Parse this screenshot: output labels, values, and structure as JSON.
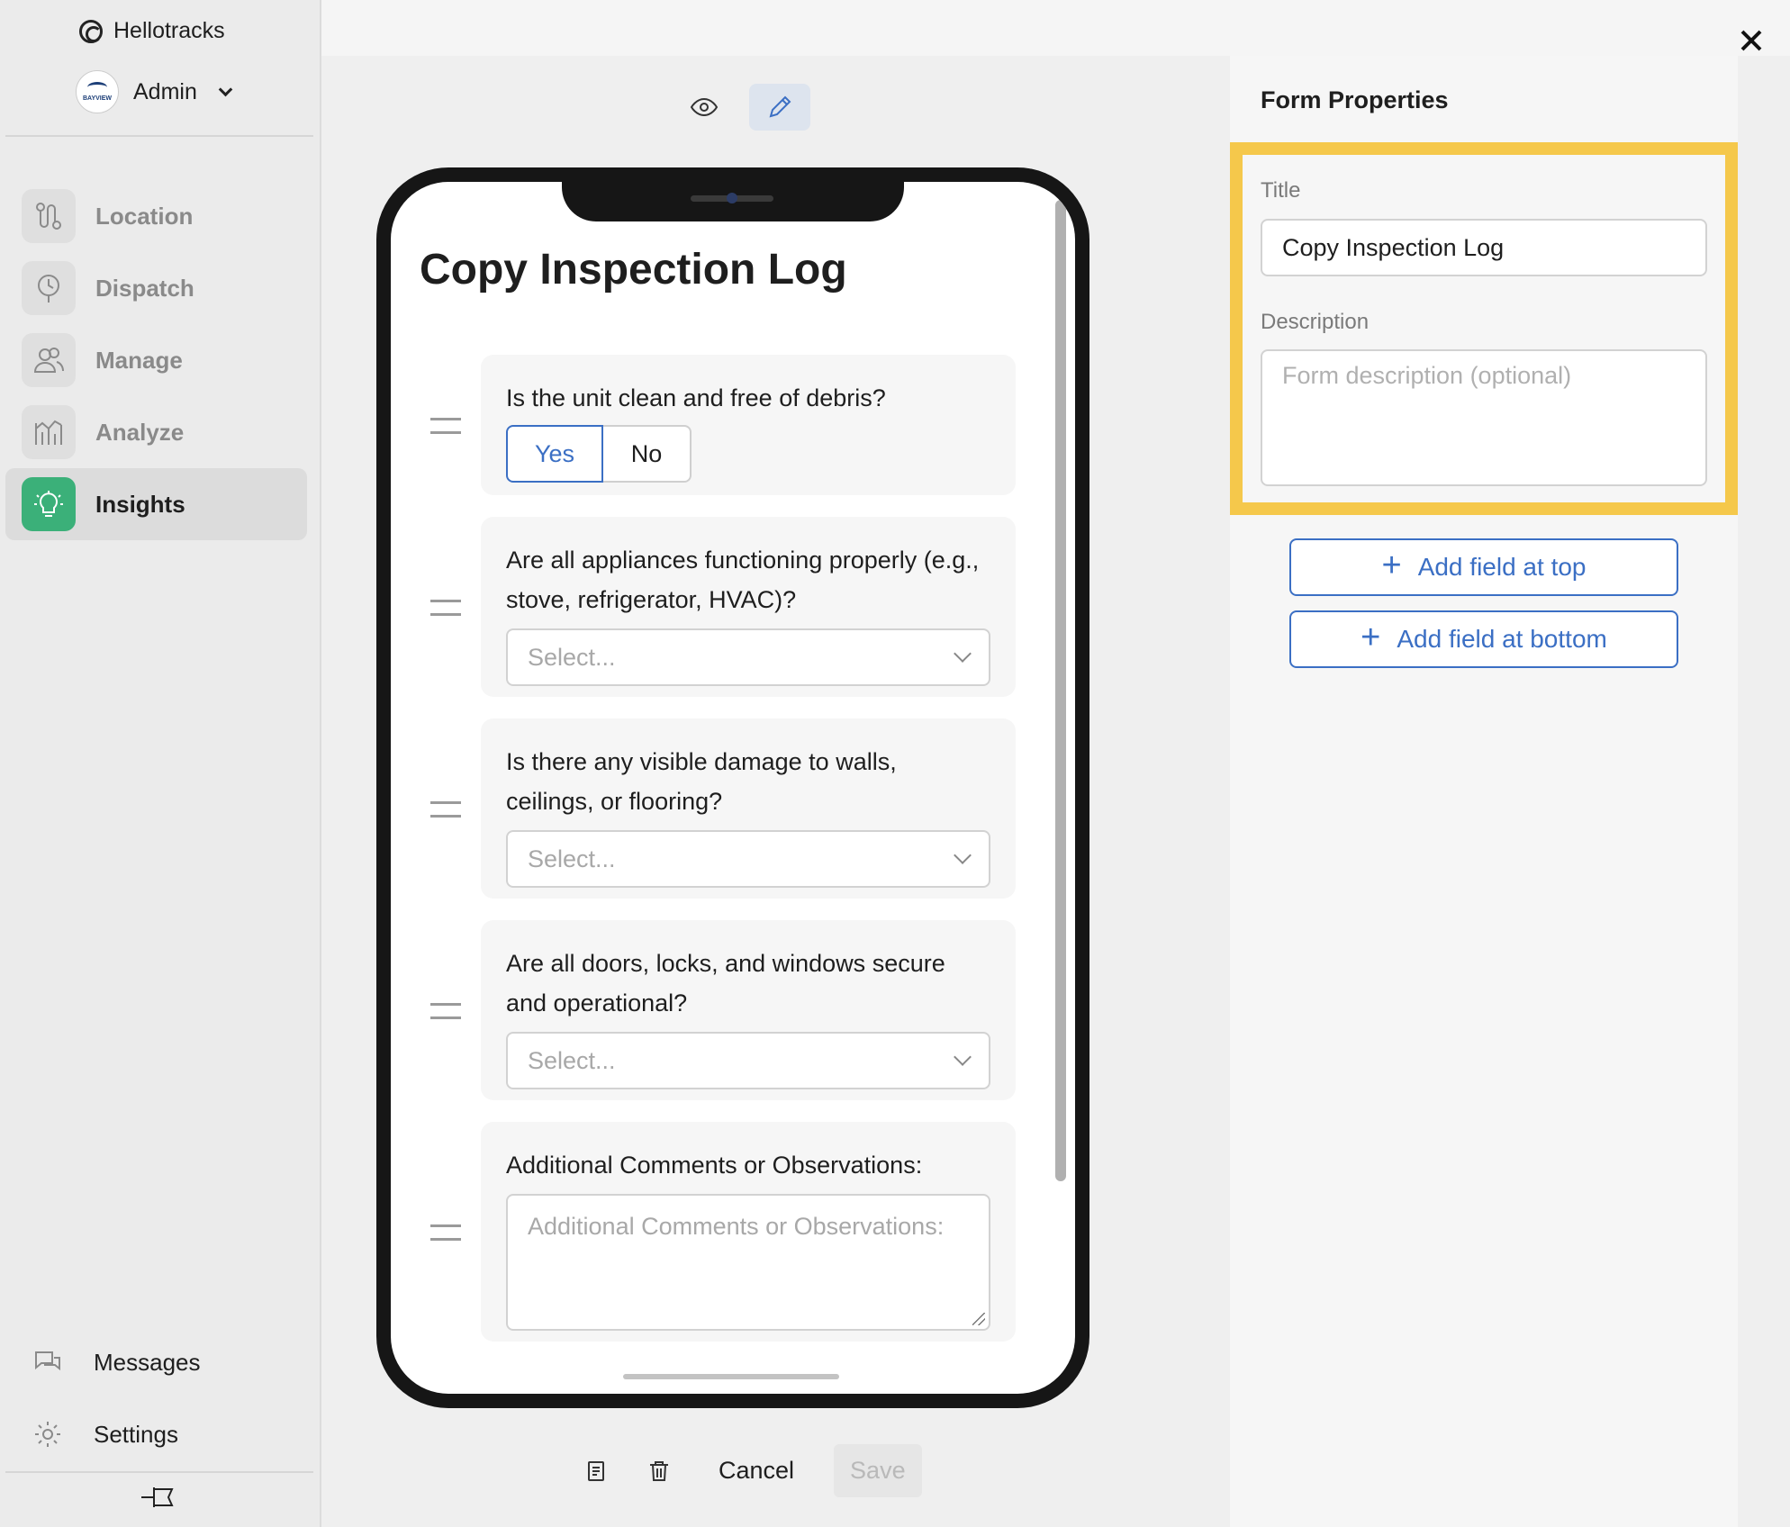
{
  "sidebar": {
    "brand": "Hellotracks",
    "account": {
      "name": "Admin",
      "avatar_text": "BAYVIEW"
    },
    "nav": [
      {
        "label": "Location",
        "icon": "location-route-icon"
      },
      {
        "label": "Dispatch",
        "icon": "dispatch-clock-icon"
      },
      {
        "label": "Manage",
        "icon": "manage-users-icon"
      },
      {
        "label": "Analyze",
        "icon": "analyze-chart-icon"
      },
      {
        "label": "Insights",
        "icon": "insights-bulb-icon",
        "active": true
      }
    ],
    "bottom": [
      {
        "label": "Messages",
        "icon": "messages-icon"
      },
      {
        "label": "Settings",
        "icon": "settings-gear-icon"
      }
    ]
  },
  "editor": {
    "form_title": "Copy Inspection Log",
    "questions": [
      {
        "label": "Is the unit clean and free of debris?",
        "type": "yesno",
        "options": [
          "Yes",
          "No"
        ],
        "selected": "Yes"
      },
      {
        "label": "Are all appliances functioning properly (e.g., stove, refrigerator, HVAC)?",
        "type": "select",
        "placeholder": "Select..."
      },
      {
        "label": "Is there any visible damage to walls, ceilings, or flooring?",
        "type": "select",
        "placeholder": "Select..."
      },
      {
        "label": "Are all doors, locks, and windows secure and operational?",
        "type": "select",
        "placeholder": "Select..."
      },
      {
        "label": "Additional Comments or Observations:",
        "type": "textarea",
        "placeholder": "Additional Comments or Observations:"
      }
    ],
    "actions": {
      "cancel": "Cancel",
      "save": "Save"
    }
  },
  "properties": {
    "heading": "Form Properties",
    "title_label": "Title",
    "title_value": "Copy Inspection Log",
    "description_label": "Description",
    "description_placeholder": "Form description (optional)",
    "add_top": "Add field at top",
    "add_bottom": "Add field at bottom"
  },
  "colors": {
    "accent": "#3b6fc4",
    "highlight": "#f5c84b",
    "insights_green": "#3bb079"
  }
}
